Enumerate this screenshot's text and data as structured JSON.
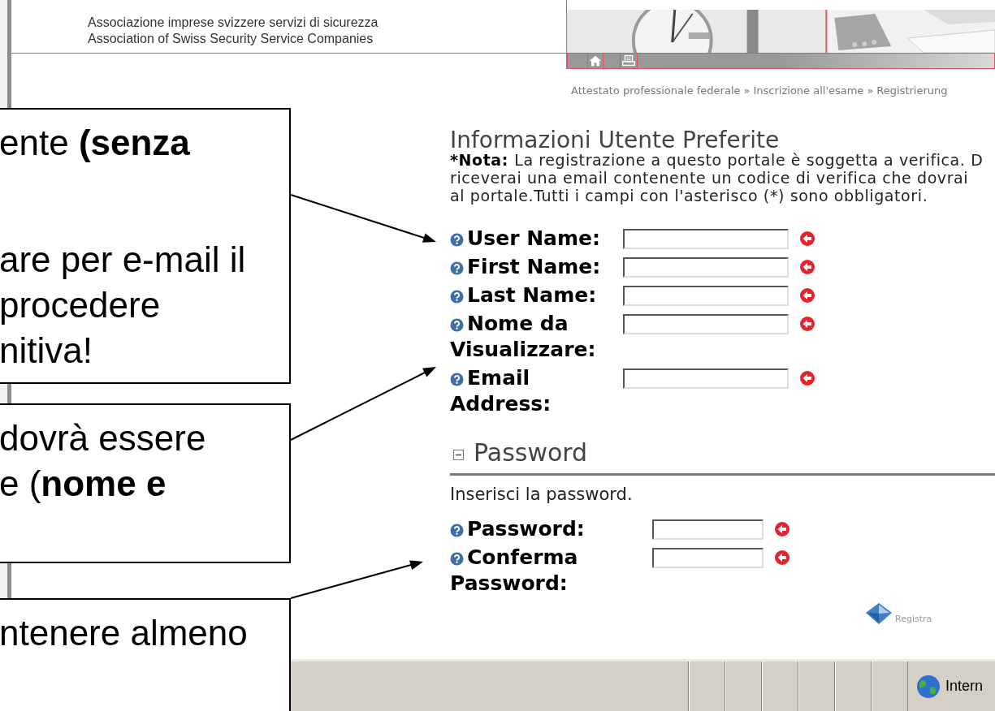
{
  "header": {
    "lines": [
      "Associazione imprese svizzere servizi di sicurezza",
      "Association of Swiss Security Service Companies"
    ]
  },
  "breadcrumb": {
    "items": [
      "Attestato professionale federale",
      "Inscrizione all'esame",
      "Registrierung"
    ],
    "separators": [
      "»",
      "»"
    ]
  },
  "form": {
    "title": "Informazioni Utente Preferite",
    "note_label": "*Nota:",
    "note_lines": [
      "La registrazione a questo portale è soggetta a verifica. D",
      "riceverai una email contenente un codice di verifica che dovrai",
      "al portale.Tutti i campi con l'asterisco (*) sono obbligatori."
    ],
    "fields": [
      {
        "label": "User Name:",
        "required": true
      },
      {
        "label": "First Name:",
        "required": true
      },
      {
        "label": "Last Name:",
        "required": true
      },
      {
        "label": "Nome da Visualizzare:",
        "required": true
      },
      {
        "label": "Email Address:",
        "required": true
      }
    ]
  },
  "password": {
    "title": "Password",
    "expanded": true,
    "hint": "Inserisci la password.",
    "fields": [
      {
        "label": "Password:",
        "required": true
      },
      {
        "label": "Conferma Password:",
        "required": true
      }
    ],
    "submit": "Registra"
  },
  "status_bar": {
    "zone": "Intern"
  },
  "callouts": [
    {
      "paragraphs": [
        [
          "ente **(senza**"
        ],
        [
          "are per e-mail il",
          "procedere",
          "nitiva!"
        ]
      ]
    },
    {
      "paragraphs": [
        [
          "dovrà essere",
          "e (**nome e**"
        ]
      ]
    },
    {
      "paragraphs": [
        [
          "ntenere almeno"
        ]
      ]
    }
  ]
}
